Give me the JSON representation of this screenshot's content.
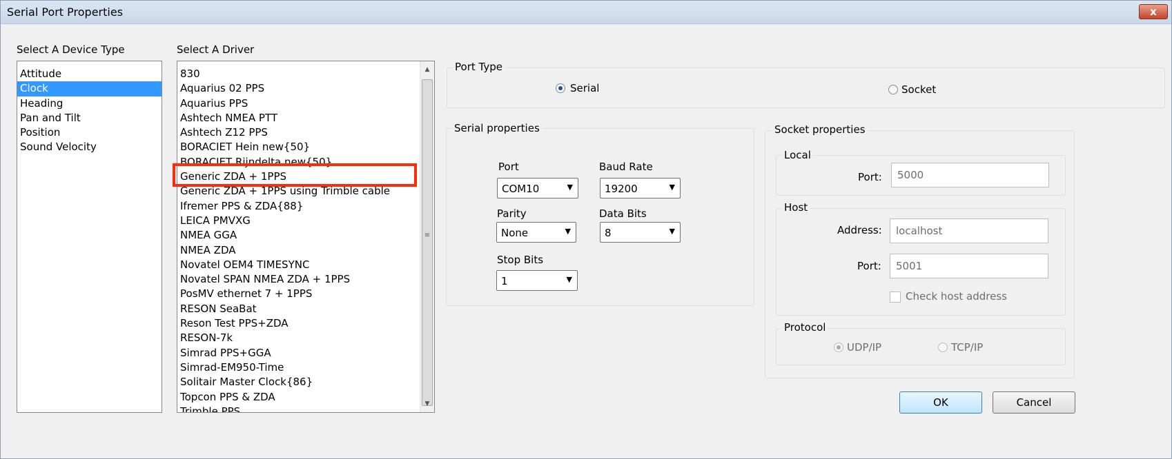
{
  "window": {
    "title": "Serial Port Properties",
    "close_label": "x"
  },
  "device_type": {
    "label": "Select A Device Type",
    "items": [
      "Attitude",
      "Clock",
      "Heading",
      "Pan and Tilt",
      "Position",
      "Sound Velocity"
    ],
    "selected": "Clock"
  },
  "driver": {
    "label": "Select A Driver",
    "items": [
      "830",
      "Aquarius 02 PPS",
      "Aquarius PPS",
      "Ashtech NMEA PTT",
      "Ashtech Z12 PPS",
      "BORACIET Hein new{50}",
      "BORACIET Rijndelta new{50}",
      "Generic ZDA + 1PPS",
      "Generic ZDA + 1PPS using Trimble cable",
      "Ifremer PPS & ZDA{88}",
      "LEICA PMVXG",
      "NMEA GGA",
      "NMEA ZDA",
      "Novatel OEM4 TIMESYNC",
      "Novatel SPAN NMEA ZDA + 1PPS",
      "PosMV ethernet 7 + 1PPS",
      "RESON SeaBat",
      "Reson Test PPS+ZDA",
      "RESON-7k",
      "Simrad PPS+GGA",
      "Simrad-EM950-Time",
      "Solitair Master Clock{86}",
      "Topcon PPS & ZDA",
      "Trimble PPS"
    ],
    "highlighted": "Generic ZDA + 1PPS"
  },
  "port_type": {
    "label": "Port Type",
    "serial": "Serial",
    "socket": "Socket",
    "selected": "Serial"
  },
  "serial": {
    "label": "Serial properties",
    "port": {
      "label": "Port",
      "value": "COM10"
    },
    "baud": {
      "label": "Baud Rate",
      "value": "19200"
    },
    "parity": {
      "label": "Parity",
      "value": "None"
    },
    "data_bits": {
      "label": "Data Bits",
      "value": "8"
    },
    "stop_bits": {
      "label": "Stop Bits",
      "value": "1"
    }
  },
  "socket": {
    "label": "Socket  properties",
    "local": {
      "label": "Local",
      "port_label": "Port:",
      "port_value": "5000"
    },
    "host": {
      "label": "Host",
      "address_label": "Address:",
      "address_value": "localhost",
      "port_label": "Port:",
      "port_value": "5001",
      "check_label": "Check host address"
    },
    "protocol": {
      "label": "Protocol",
      "udp": "UDP/IP",
      "tcp": "TCP/IP",
      "selected": "UDP/IP"
    }
  },
  "buttons": {
    "ok": "OK",
    "cancel": "Cancel"
  },
  "colors": {
    "selection": "#3399ff",
    "highlight": "#ff2a0a"
  }
}
